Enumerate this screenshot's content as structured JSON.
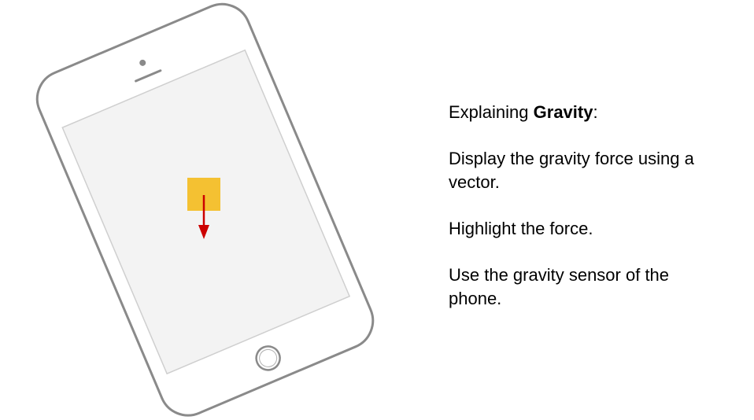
{
  "colors": {
    "phone_outline": "#8a8a8a",
    "screen_fill": "#f3f3f3",
    "screen_border": "#cfcfcf",
    "object_fill": "#f4c132",
    "vector_color": "#cc0000",
    "text": "#000000"
  },
  "heading": {
    "prefix": "Explaining ",
    "keyword": "Gravity",
    "suffix": ":"
  },
  "points": [
    "Display the gravity force using a vector.",
    "Highlight the force.",
    "Use the gravity sensor of the phone."
  ]
}
